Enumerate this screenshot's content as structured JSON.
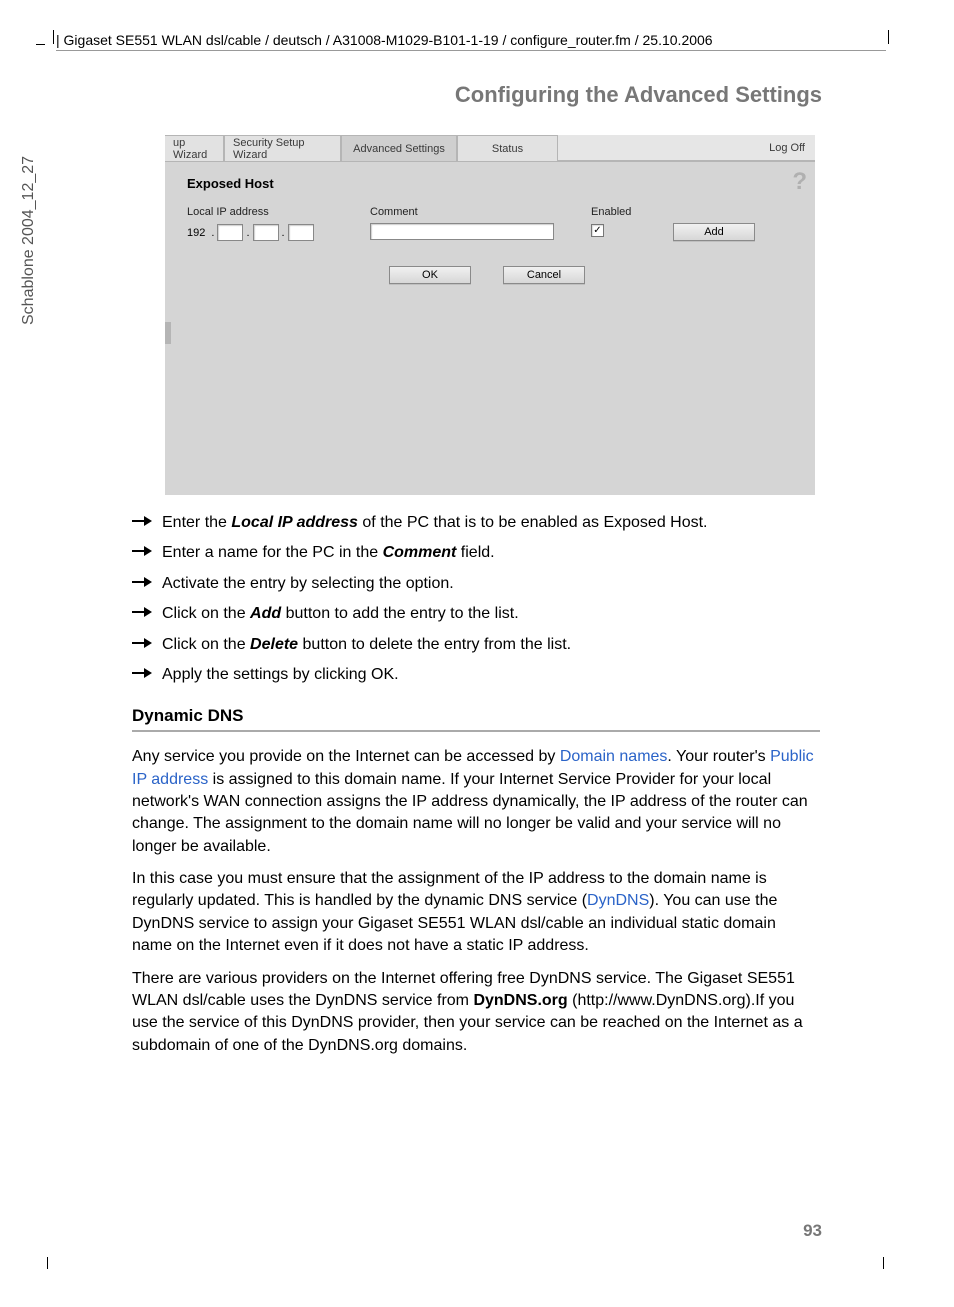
{
  "header": "| Gigaset SE551 WLAN dsl/cable / deutsch / A31008-M1029-B101-1-19 / configure_router.fm / 25.10.2006",
  "side": "Schablone 2004_12_27",
  "title": "Configuring the Advanced Settings",
  "page_number": "93",
  "ui": {
    "tabs": {
      "cut": "up Wizard",
      "sec": "Security Setup Wizard",
      "adv": "Advanced Settings",
      "stat": "Status",
      "logoff": "Log Off"
    },
    "panel_title": "Exposed Host",
    "labels": {
      "ip": "Local IP address",
      "comment": "Comment",
      "enabled": "Enabled"
    },
    "ip_prefix": "192",
    "checkbox_mark": "✓",
    "buttons": {
      "add": "Add",
      "ok": "OK",
      "cancel": "Cancel"
    },
    "help": "?"
  },
  "steps": {
    "s1a": "Enter the ",
    "s1b": "Local IP address",
    "s1c": " of the PC that is to be enabled as Exposed Host.",
    "s2a": "Enter a name for the PC in the ",
    "s2b": "Comment",
    "s2c": " field.",
    "s3": "Activate the entry by selecting the option.",
    "s4a": "Click on the ",
    "s4b": "Add",
    "s4c": " button to add the entry to the list.",
    "s5a": "Click on the ",
    "s5b": "Delete",
    "s5c": " button to delete the entry from the list.",
    "s6": "Apply the settings by clicking OK."
  },
  "section": "Dynamic DNS",
  "p1": {
    "a": "Any service you provide on the Internet can be accessed by ",
    "link1": "Domain names",
    "b": ". Your router's ",
    "link2": "Public IP address",
    "c": " is assigned to this domain name. If your Internet Service Provider for your local network's WAN connection assigns the IP address dynamically, the IP address of the router can change. The assignment to the domain name will no longer be valid and your service will no longer be available."
  },
  "p2": {
    "a": "In this case you must ensure that the assignment of the IP address to the domain name is regularly updated. This is handled by the dynamic DNS service (",
    "link": "DynDNS",
    "b": "). You can use the DynDNS service to assign your Gigaset SE551 WLAN dsl/cable an individual static domain name on the Internet even if it does not have a static IP address."
  },
  "p3": {
    "a": "There are various providers on the Internet offering free DynDNS service. The Gigaset SE551 WLAN dsl/cable uses the DynDNS service from ",
    "bold": "DynDNS.org",
    "b": " (http://www.DynDNS.org).If you use the service of this DynDNS provider, then your service can be reached on the Internet as a subdomain of one of the DynDNS.org domains."
  }
}
